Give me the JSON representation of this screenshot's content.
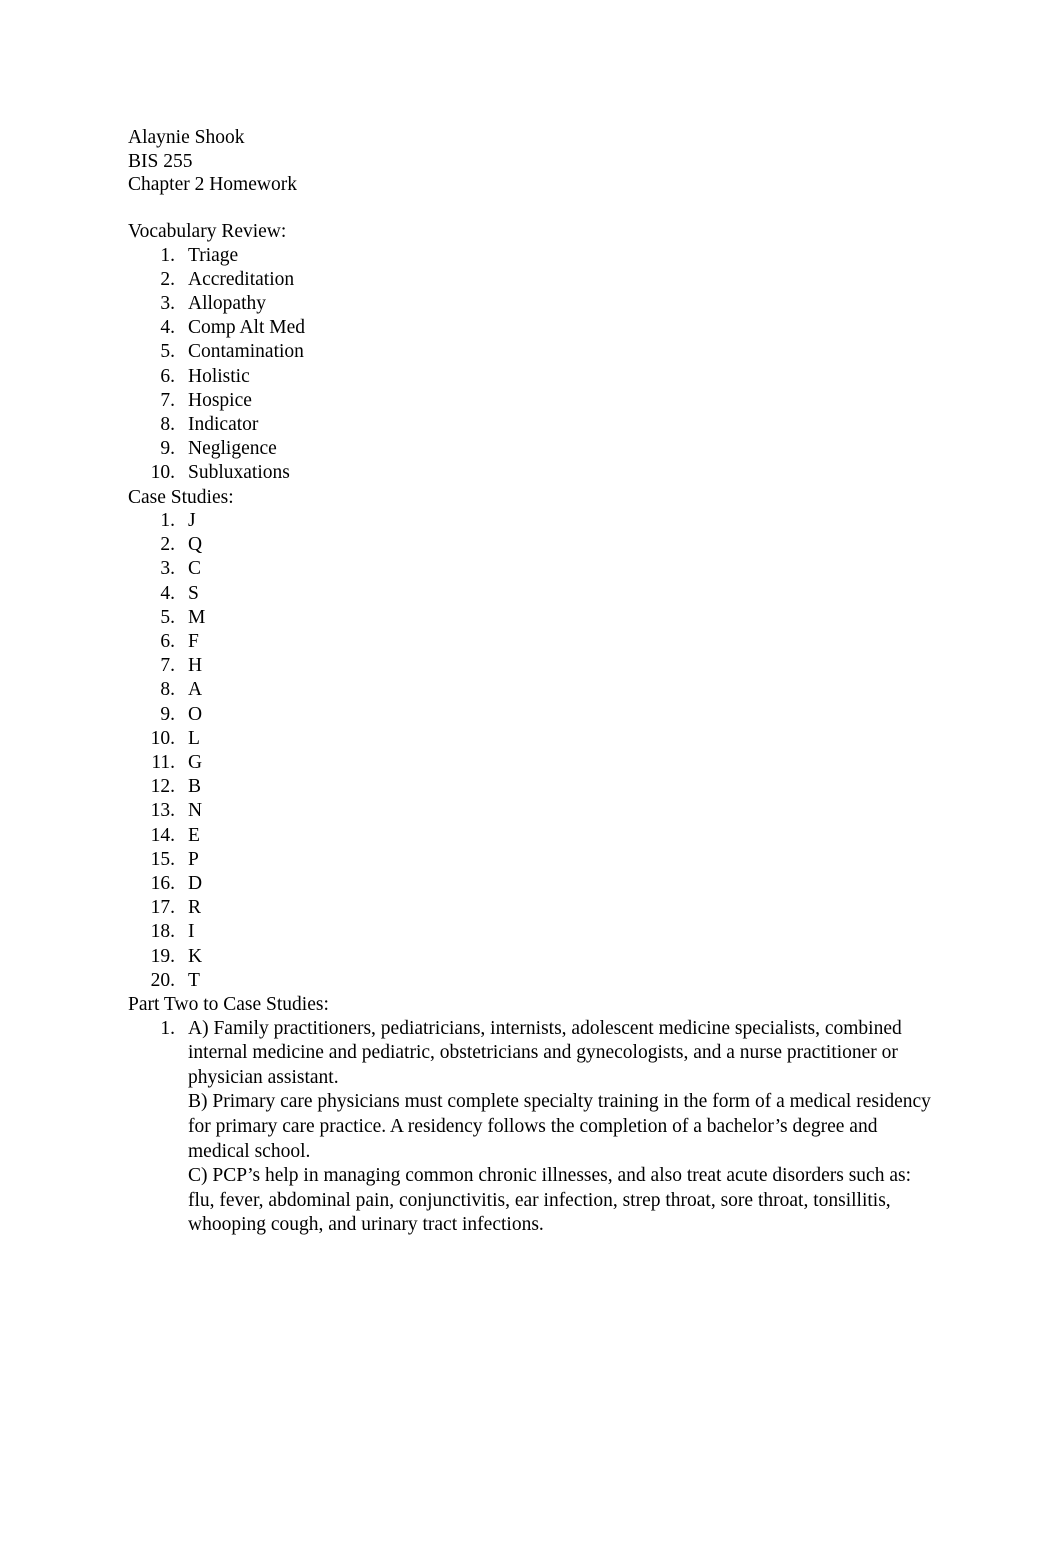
{
  "document": {
    "header": {
      "student_name": "Alaynie Shook",
      "course": "BIS 255",
      "assignment": "Chapter 2 Homework"
    },
    "sections": [
      {
        "label": "Vocabulary Review:",
        "items": [
          "Triage",
          "Accreditation",
          "Allopathy",
          "Comp Alt Med",
          "Contamination",
          "Holistic",
          "Hospice",
          "Indicator",
          "Negligence",
          "Subluxations"
        ]
      },
      {
        "label": "Case Studies:",
        "items": [
          "J",
          "Q",
          "C",
          "S",
          "M",
          "F",
          "H",
          "A",
          "O",
          "L",
          "G",
          "B",
          "N",
          "E",
          "P",
          "D",
          "R",
          "I",
          "K",
          "T"
        ]
      }
    ],
    "part_two": {
      "label": "Part Two to Case Studies:",
      "answers": [
        {
          "marker": "1.",
          "parts": [
            "A) Family practitioners, pediatricians, internists, adolescent medicine specialists, combined internal medicine and pediatric, obstetricians and gynecologists, and a nurse practitioner or physician assistant.",
            "B) Primary care physicians must complete specialty training in the form of a medical residency for primary care practice. A residency follows the completion of a bachelor’s degree and medical school.",
            "C) PCP’s help in managing common chronic illnesses, and also treat acute disorders such as: flu, fever, abdominal pain, conjunctivitis, ear infection, strep throat, sore throat, tonsillitis, whooping cough, and urinary tract infections."
          ]
        }
      ]
    },
    "markers": {
      "1": "1.",
      "2": "2.",
      "3": "3.",
      "4": "4.",
      "5": "5.",
      "6": "6.",
      "7": "7.",
      "8": "8.",
      "9": "9.",
      "10": "10.",
      "11": "11.",
      "12": "12.",
      "13": "13.",
      "14": "14.",
      "15": "15.",
      "16": "16.",
      "17": "17.",
      "18": "18.",
      "19": "19.",
      "20": "20."
    },
    "colors": {
      "page_background": "#ffffff",
      "text": "#000000"
    }
  }
}
